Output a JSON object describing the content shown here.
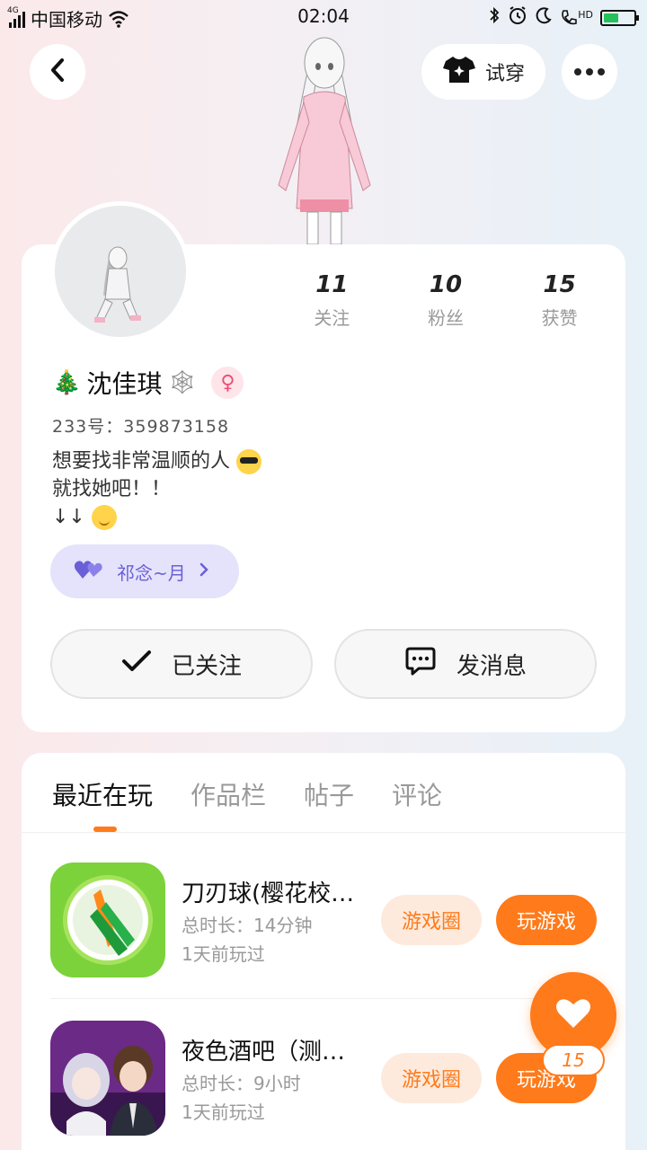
{
  "status_bar": {
    "network": "4G",
    "carrier": "中国移动",
    "time": "02:04",
    "hd": "HD"
  },
  "header": {
    "tryon_label": "试穿"
  },
  "profile": {
    "stats": [
      {
        "value": "11",
        "label": "关注"
      },
      {
        "value": "10",
        "label": "粉丝"
      },
      {
        "value": "15",
        "label": "获赞"
      }
    ],
    "name": "沈佳琪",
    "name_prefix_emoji": "🎄",
    "name_suffix_emoji": "🕸",
    "gender_symbol": "♀",
    "uid": "233号：359873158",
    "bio_line1": "想要找非常温顺的人",
    "bio_line2": "就找她吧！！",
    "bio_line3": "↓↓",
    "moon_label": "祁念~月",
    "follow_label": "已关注",
    "message_label": "发消息"
  },
  "tabs": [
    {
      "label": "最近在玩",
      "active": true
    },
    {
      "label": "作品栏",
      "active": false
    },
    {
      "label": "帖子",
      "active": false
    },
    {
      "label": "评论",
      "active": false
    }
  ],
  "games": [
    {
      "title": "刀刃球(樱花校…",
      "time": "总时长：14分钟",
      "last": "1天前玩过",
      "circle_label": "游戏圈",
      "play_label": "玩游戏"
    },
    {
      "title": "夜色酒吧（测…",
      "time": "总时长：9小时",
      "last": "1天前玩过",
      "circle_label": "游戏圈",
      "play_label": "玩游戏"
    }
  ],
  "like_count": "15",
  "colors": {
    "accent": "#ff7a1a",
    "accent_light": "#fdeadc",
    "purple": "#6a5fd6",
    "pink": "#ee4f75"
  }
}
